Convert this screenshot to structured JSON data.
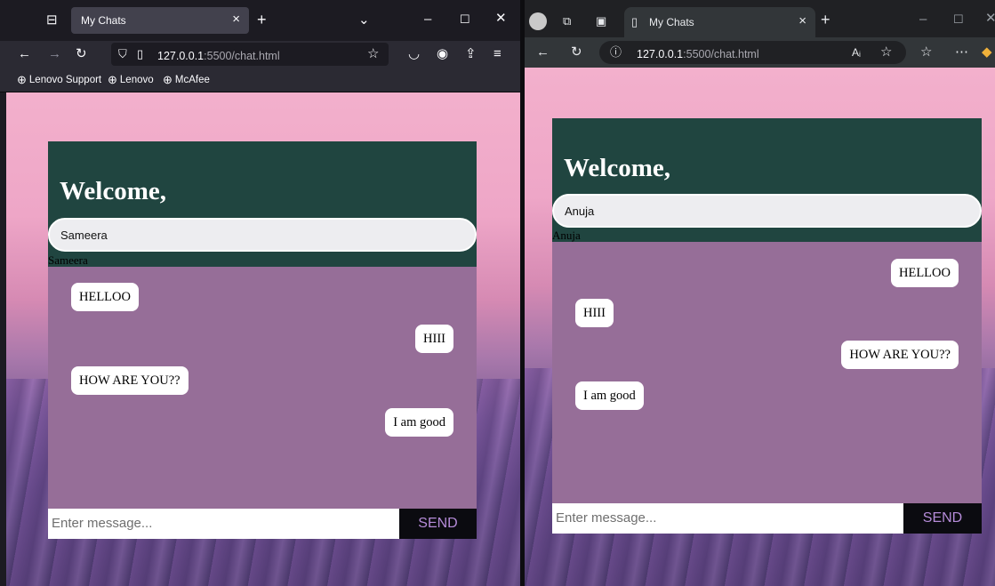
{
  "colors": {
    "header_bg": "#204540",
    "messages_bg": "#966e98",
    "send_bg": "#0b0b10",
    "send_text": "#b58bd8",
    "bubble_bg": "#ffffff"
  },
  "left_window": {
    "browser": "Firefox",
    "tab": {
      "title": "My Chats",
      "close": "×",
      "new_tab": "+"
    },
    "url": {
      "host": "127.0.0.1",
      "path": ":5500/chat.html"
    },
    "bookmarks": [
      {
        "label": "Lenovo Support"
      },
      {
        "label": "Lenovo"
      },
      {
        "label": "McAfee"
      }
    ],
    "chat": {
      "welcome": "Welcome,",
      "name_value": "Sameera",
      "name_label": "Sameera",
      "messages": [
        {
          "text": "HELLOO",
          "side": "left"
        },
        {
          "text": "HIII",
          "side": "right"
        },
        {
          "text": "HOW ARE YOU??",
          "side": "left"
        },
        {
          "text": "I am good",
          "side": "right"
        }
      ],
      "input_placeholder": "Enter message...",
      "send_label": "SEND"
    }
  },
  "right_window": {
    "browser": "Edge",
    "tab": {
      "title": "My Chats",
      "close": "×",
      "new_tab": "+"
    },
    "url": {
      "host": "127.0.0.1",
      "path": ":5500/chat.html"
    },
    "chat": {
      "welcome": "Welcome,",
      "name_value": "Anuja",
      "name_label": "Anuja",
      "messages": [
        {
          "text": "HELLOO",
          "side": "right"
        },
        {
          "text": "HIII",
          "side": "left"
        },
        {
          "text": "HOW ARE YOU??",
          "side": "right"
        },
        {
          "text": "I am good",
          "side": "left"
        }
      ],
      "input_placeholder": "Enter message...",
      "send_label": "SEND"
    }
  }
}
